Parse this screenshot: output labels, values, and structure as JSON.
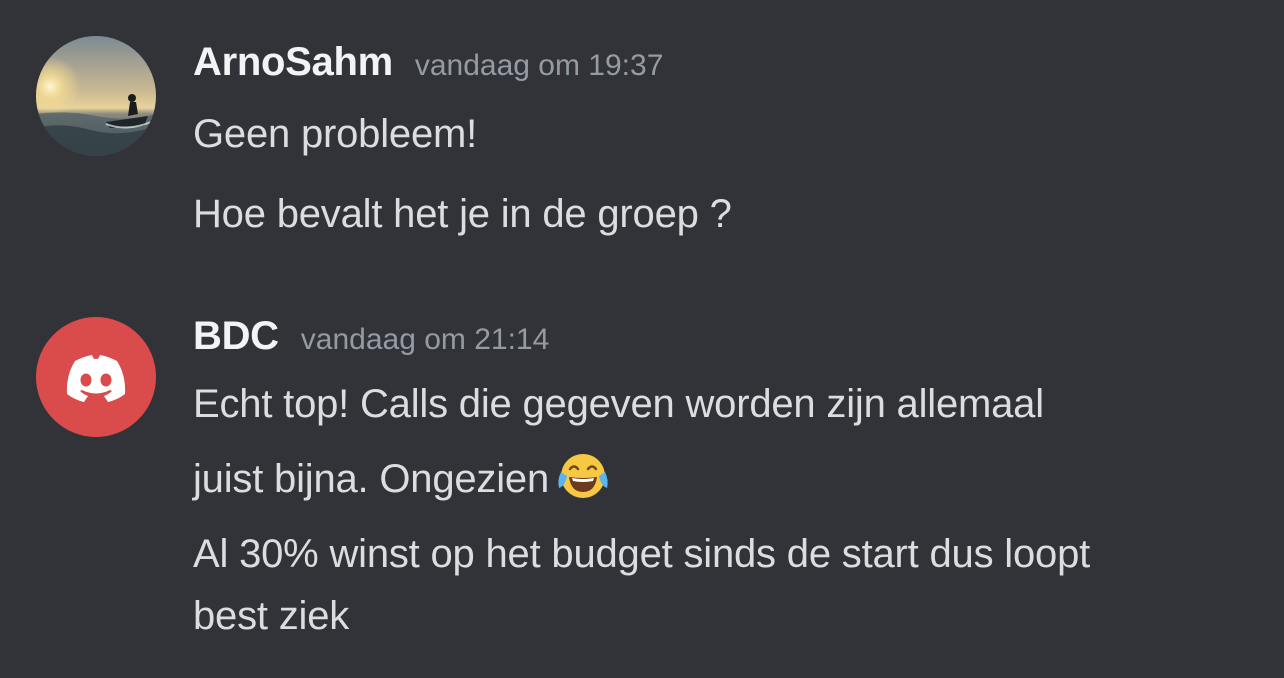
{
  "messages": [
    {
      "author": "ArnoSahm",
      "timestamp": "vandaag om 19:37",
      "avatar": "jet-ski-at-sunset-photo",
      "lines": [
        "Geen probleem!",
        "Hoe bevalt het je in de groep ?"
      ]
    },
    {
      "author": "BDC",
      "timestamp": "vandaag om 21:14",
      "avatar": "discord-logo-icon",
      "avatar_color": "#da4b4b",
      "lines": [
        "Echt top! Calls die gegeven worden zijn allemaal",
        "juist bijna. Ongezien",
        "Al 30% winst op het budget sinds de start dus loopt",
        "best ziek"
      ],
      "emoji": "face-with-tears-of-joy"
    }
  ],
  "colors": {
    "background": "#313338",
    "username": "#f2f3f5",
    "timestamp": "#949ba4",
    "text": "#dbdee1"
  }
}
